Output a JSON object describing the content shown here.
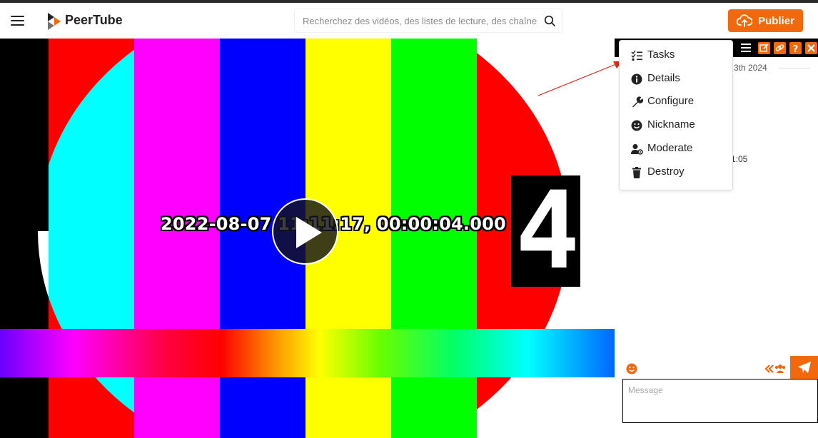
{
  "header": {
    "app_name": "PeerTube",
    "search_placeholder": "Recherchez des vidéos, des listes de lecture, des chaînes…",
    "publish_label": "Publier",
    "accent_color": "#f1680d"
  },
  "video": {
    "overlay_timestamp": "2022-08-07 11:11:17, 00:00:04.000",
    "countdown_digit": "4"
  },
  "chat": {
    "date_separator": "3th 2024",
    "message_time": "1:05",
    "message_placeholder": "Message",
    "toolbar_icons": [
      "menu-icon",
      "edit-icon",
      "link-icon",
      "help-icon",
      "close-icon"
    ]
  },
  "menu": {
    "items": [
      {
        "label": "Tasks",
        "icon": "tasks-icon"
      },
      {
        "label": "Details",
        "icon": "info-icon"
      },
      {
        "label": "Configure",
        "icon": "wrench-icon"
      },
      {
        "label": "Nickname",
        "icon": "smile-icon"
      },
      {
        "label": "Moderate",
        "icon": "user-cog-icon"
      },
      {
        "label": "Destroy",
        "icon": "trash-icon"
      }
    ]
  }
}
